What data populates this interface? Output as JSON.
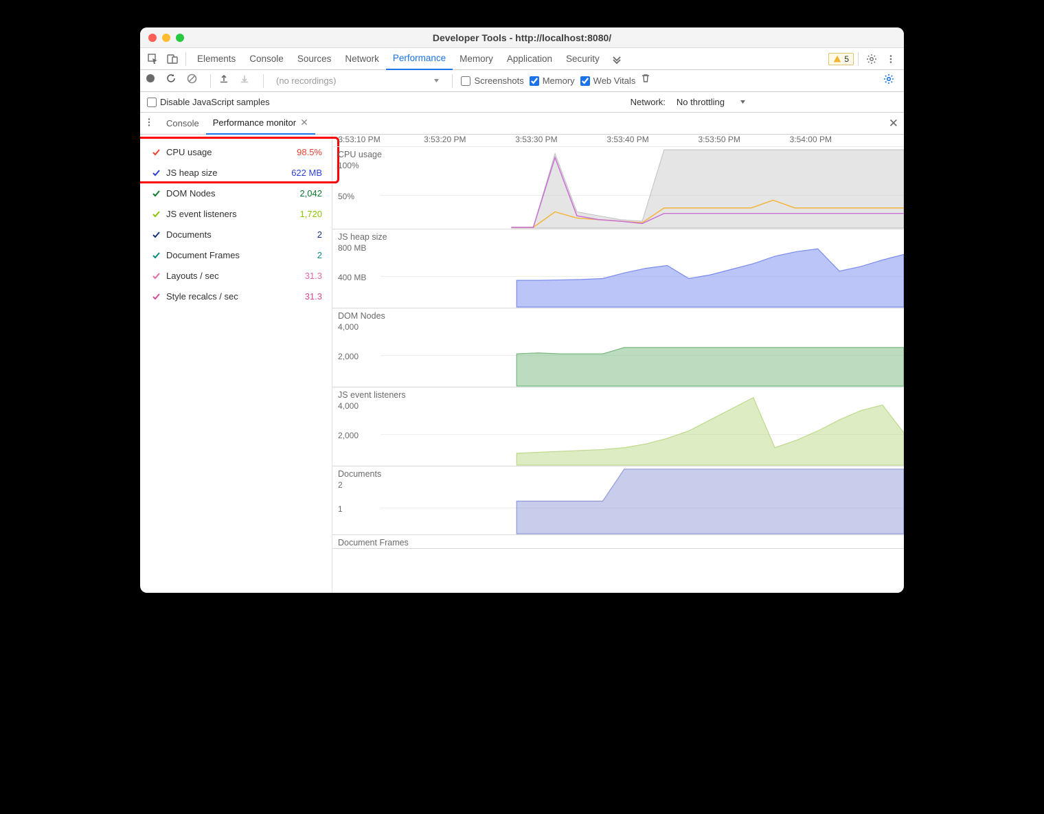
{
  "window": {
    "title": "Developer Tools - http://localhost:8080/"
  },
  "tabs": {
    "items": [
      "Elements",
      "Console",
      "Sources",
      "Network",
      "Performance",
      "Memory",
      "Application",
      "Security"
    ],
    "active": "Performance",
    "warning_count": "5"
  },
  "perf_toolbar": {
    "recordings_placeholder": "(no recordings)",
    "screenshots_label": "Screenshots",
    "screenshots_checked": false,
    "memory_label": "Memory",
    "memory_checked": true,
    "webvitals_label": "Web Vitals",
    "webvitals_checked": true
  },
  "disable_row": {
    "disable_js_label": "Disable JavaScript samples",
    "disable_js_checked": false,
    "network_label": "Network:",
    "network_value": "No throttling"
  },
  "drawer": {
    "tabs": [
      "Console",
      "Performance monitor"
    ],
    "active": "Performance monitor"
  },
  "metrics": [
    {
      "label": "CPU usage",
      "value": "98.5%",
      "color": "#e8412f"
    },
    {
      "label": "JS heap size",
      "value": "622 MB",
      "color": "#2b3fd8"
    },
    {
      "label": "DOM Nodes",
      "value": "2,042",
      "color": "#0a7a2f"
    },
    {
      "label": "JS event listeners",
      "value": "1,720",
      "color": "#8ac400"
    },
    {
      "label": "Documents",
      "value": "2",
      "color": "#16327a"
    },
    {
      "label": "Document Frames",
      "value": "2",
      "color": "#0a8a7a"
    },
    {
      "label": "Layouts / sec",
      "value": "31.3",
      "color": "#e46aa8"
    },
    {
      "label": "Style recalcs / sec",
      "value": "31.3",
      "color": "#d24d93"
    }
  ],
  "colors": {
    "cpu_gray": "#bfbfbf",
    "cpu_orange": "#f4b43a",
    "cpu_purple": "#c96fd6",
    "heap": "#7a8bf0",
    "dom": "#77b97f",
    "listeners": "#bdd98a",
    "docs": "#8f9bd6"
  },
  "time_axis": {
    "ticks": [
      "3:53:10 PM",
      "3:53:20 PM",
      "3:53:30 PM",
      "3:53:40 PM",
      "3:53:50 PM",
      "3:54:00 PM"
    ],
    "positions_pct": [
      1,
      16,
      32,
      48,
      64,
      80
    ]
  },
  "chart_data": [
    {
      "type": "line",
      "title": "CPU usage",
      "ylabel": "",
      "ylim": [
        0,
        100
      ],
      "yticks": [
        "100%",
        "50%"
      ],
      "series": [
        {
          "name": "gray",
          "values": [
            0,
            0,
            95,
            20,
            15,
            10,
            8,
            100,
            100,
            100,
            100,
            100,
            100,
            100,
            100,
            100,
            100,
            100,
            100
          ]
        },
        {
          "name": "orange",
          "values": [
            0,
            0,
            20,
            12,
            10,
            8,
            6,
            25,
            25,
            25,
            25,
            25,
            35,
            25,
            25,
            25,
            25,
            25,
            25
          ]
        },
        {
          "name": "purple",
          "values": [
            0,
            0,
            90,
            15,
            10,
            8,
            5,
            18,
            18,
            18,
            18,
            18,
            18,
            18,
            18,
            18,
            18,
            18,
            18
          ]
        }
      ],
      "x_start_pct": 25
    },
    {
      "type": "area",
      "title": "JS heap size",
      "ylabel": "",
      "ylim": [
        0,
        800
      ],
      "yticks": [
        "800 MB",
        "400 MB"
      ],
      "series": [
        {
          "name": "heap",
          "values": [
            280,
            280,
            285,
            290,
            300,
            360,
            410,
            440,
            300,
            340,
            400,
            460,
            540,
            590,
            620,
            380,
            430,
            500,
            560
          ]
        }
      ],
      "x_start_pct": 26
    },
    {
      "type": "area",
      "title": "DOM Nodes",
      "ylabel": "",
      "ylim": [
        0,
        4000
      ],
      "yticks": [
        "4,000",
        "2,000"
      ],
      "series": [
        {
          "name": "dom",
          "values": [
            1700,
            1750,
            1700,
            1700,
            1700,
            2040,
            2040,
            2040,
            2040,
            2040,
            2040,
            2040,
            2040,
            2040,
            2040,
            2040,
            2040,
            2040,
            2040
          ]
        }
      ],
      "x_start_pct": 26
    },
    {
      "type": "area",
      "title": "JS event listeners",
      "ylabel": "",
      "ylim": [
        0,
        4000
      ],
      "yticks": [
        "4,000",
        "2,000"
      ],
      "series": [
        {
          "name": "listeners",
          "values": [
            600,
            650,
            700,
            750,
            800,
            900,
            1100,
            1400,
            1800,
            2400,
            3000,
            3600,
            900,
            1300,
            1800,
            2400,
            2900,
            3200,
            1700
          ]
        }
      ],
      "x_start_pct": 26
    },
    {
      "type": "area",
      "title": "Documents",
      "ylabel": "",
      "ylim": [
        0,
        2
      ],
      "yticks": [
        "2",
        "1"
      ],
      "series": [
        {
          "name": "docs",
          "values": [
            1,
            1,
            1,
            1,
            1,
            2,
            2,
            2,
            2,
            2,
            2,
            2,
            2,
            2,
            2,
            2,
            2,
            2,
            2
          ]
        }
      ],
      "x_start_pct": 26
    },
    {
      "type": "area",
      "title": "Document Frames",
      "ylabel": "",
      "ylim": [
        0,
        2
      ],
      "yticks": [],
      "series": [],
      "x_start_pct": 26
    }
  ]
}
